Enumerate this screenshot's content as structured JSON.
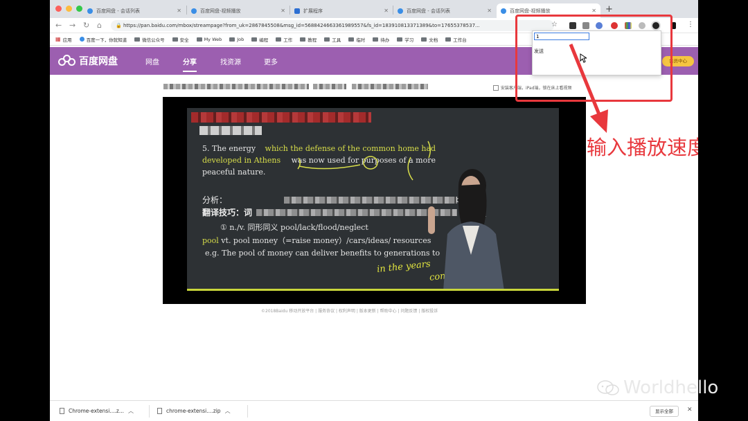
{
  "browser": {
    "tabs": [
      {
        "title": "百度网盘 - 会话列表",
        "active": false
      },
      {
        "title": "百度网盘-视频播放",
        "active": false
      },
      {
        "title": "扩展程序",
        "active": false
      },
      {
        "title": "百度网盘 - 会话列表",
        "active": false
      },
      {
        "title": "百度网盘-视频播放",
        "active": true
      }
    ],
    "url": "https://pan.baidu.com/mbox/streampage?from_uk=2867845508&msg_id=5688424663361989557&fs_id=183910813371389&to=17655378537..."
  },
  "bookmarks": [
    "应用",
    "百度一下，你就知道",
    "微信公众号",
    "安全",
    "My Web",
    "Job",
    "编程",
    "工作",
    "教程",
    "工具",
    "临时",
    "待办",
    "学习",
    "文档",
    "工作台"
  ],
  "site": {
    "logo": "百度网盘",
    "nav": [
      "网盘",
      "分享",
      "找资源",
      "更多"
    ],
    "active_nav": "分享",
    "vip_label": "会员中心"
  },
  "page": {
    "checkbox_label": "安装客户端，iPad端，锁在床上看视频"
  },
  "video": {
    "line1a": "5.  The energy",
    "line1b": "which the defense of the common home had",
    "line2a": "developed in Athens",
    "line2b": "was now used for purposes of a more",
    "line3": "peaceful nature.",
    "analysis": "分析：",
    "tips": "翻译技巧：词",
    "watermark_text": "程班",
    "vip_text": "bvip",
    "item1": "① n./v. 同形同义  pool/lack/flood/neglect",
    "item2_word": "pool",
    "item2_rest": " vt. pool money（=raise money）/cars/ideas/ resources",
    "item3": "e.g. The pool of money can deliver benefits to generations to",
    "handwriting1": "in the years",
    "handwriting2": "come"
  },
  "footer": "©2018Baidu  移动开放平台 | 服务协议 | 权利声明 | 版本更新 | 帮助中心 | 问题反馈 | 版权投诉",
  "popup": {
    "input_value": "1",
    "send_label": "发送"
  },
  "annotation": {
    "caption": "输入播放速度"
  },
  "downloads": {
    "items": [
      "Chrome-extensi....z...",
      "chrome-extensi....zip"
    ],
    "show_all": "显示全部"
  },
  "watermark": "Worldhello",
  "colors": {
    "site_purple": "#9c5fb0",
    "annotation_red": "#e8383d",
    "board_bg": "#2d3134",
    "chalk_yellow": "#d9df4a"
  }
}
